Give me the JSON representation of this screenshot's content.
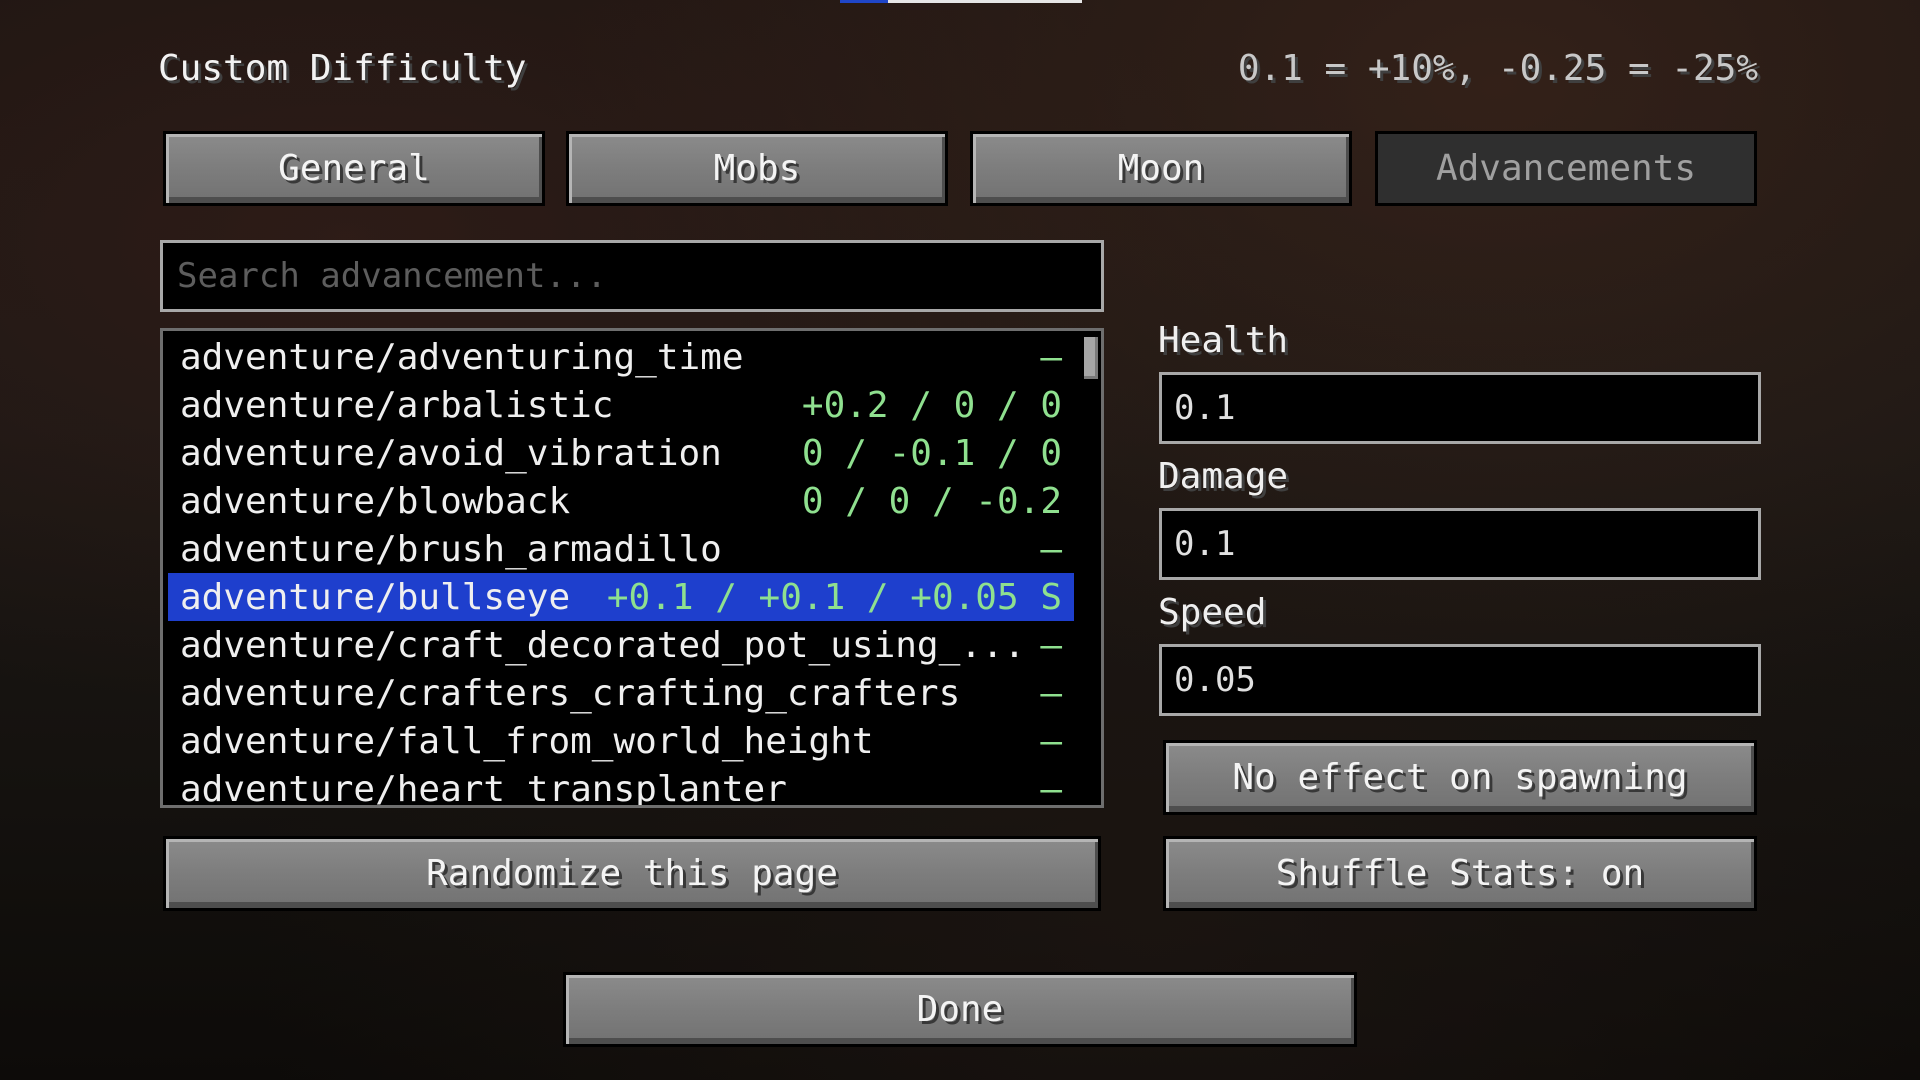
{
  "screen": {
    "title": "Custom Difficulty",
    "info": "0.1 = +10%,  -0.25 = -25%"
  },
  "tabs": [
    {
      "label": "General",
      "active": false
    },
    {
      "label": "Mobs",
      "active": false
    },
    {
      "label": "Moon",
      "active": false
    },
    {
      "label": "Advancements",
      "active": true
    }
  ],
  "search": {
    "placeholder": "Search advancement...",
    "value": ""
  },
  "advancements": [
    {
      "name": "adventure/adventuring_time",
      "value": "—",
      "selected": false
    },
    {
      "name": "adventure/arbalistic",
      "value": "+0.2 / 0 / 0",
      "selected": false
    },
    {
      "name": "adventure/avoid_vibration",
      "value": "0 / -0.1 / 0",
      "selected": false
    },
    {
      "name": "adventure/blowback",
      "value": "0 / 0 / -0.2",
      "selected": false
    },
    {
      "name": "adventure/brush_armadillo",
      "value": "—",
      "selected": false
    },
    {
      "name": "adventure/bullseye",
      "value": "+0.1 / +0.1 / +0.05 S",
      "selected": true
    },
    {
      "name": "adventure/craft_decorated_pot_using_...",
      "value": "—",
      "selected": false
    },
    {
      "name": "adventure/crafters_crafting_crafters",
      "value": "—",
      "selected": false
    },
    {
      "name": "adventure/fall_from_world_height",
      "value": "—",
      "selected": false
    },
    {
      "name": "adventure/heart_transplanter",
      "value": "—",
      "selected": false
    }
  ],
  "stats": {
    "health_label": "Health",
    "health_value": "0.1",
    "damage_label": "Damage",
    "damage_value": "0.1",
    "speed_label": "Speed",
    "speed_value": "0.05"
  },
  "buttons": {
    "spawn": "No effect on spawning",
    "shuffle": "Shuffle Stats: on",
    "randomize": "Randomize this page",
    "done": "Done"
  },
  "colors": {
    "selection": "#1e3fcd",
    "value_text": "#8fe08f"
  }
}
